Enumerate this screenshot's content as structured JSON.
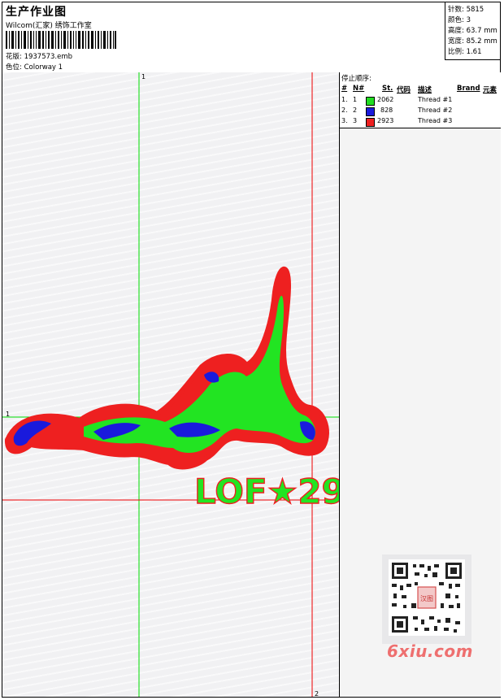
{
  "header": {
    "title": "生产作业图",
    "subtitle": "Wilcom(汇家) 绣饰工作室",
    "design_label": "花版: 1937573.emb",
    "colorway_label": "色位: Colorway 1"
  },
  "stats": {
    "stitches": "针数: 5815",
    "colors": "颜色: 3",
    "height": "高度: 63.7 mm",
    "width": "宽度: 85.2 mm",
    "scale": "比例: 1.61"
  },
  "stop_sequence": {
    "title": "停止顺序:",
    "headers": {
      "hash": "#",
      "no": "N#",
      "st": "St.",
      "code": "代码",
      "desc": "描述",
      "brand": "Brand",
      "elem": "元素"
    },
    "rows": [
      {
        "idx": "1.",
        "no": "1",
        "st": "2062",
        "desc": "Thread #1",
        "color": "#22dd22"
      },
      {
        "idx": "2.",
        "no": "2",
        "st": "828",
        "desc": "Thread #2",
        "color": "#1a1adc"
      },
      {
        "idx": "3.",
        "no": "3",
        "st": "2923",
        "desc": "Thread #3",
        "color": "#ee2020"
      }
    ]
  },
  "guides": {
    "v1": "1",
    "h1": "1",
    "v2": "2"
  },
  "design_text": "LOF★29",
  "watermark": "6xiu.com",
  "qr_stamp": "汉图"
}
